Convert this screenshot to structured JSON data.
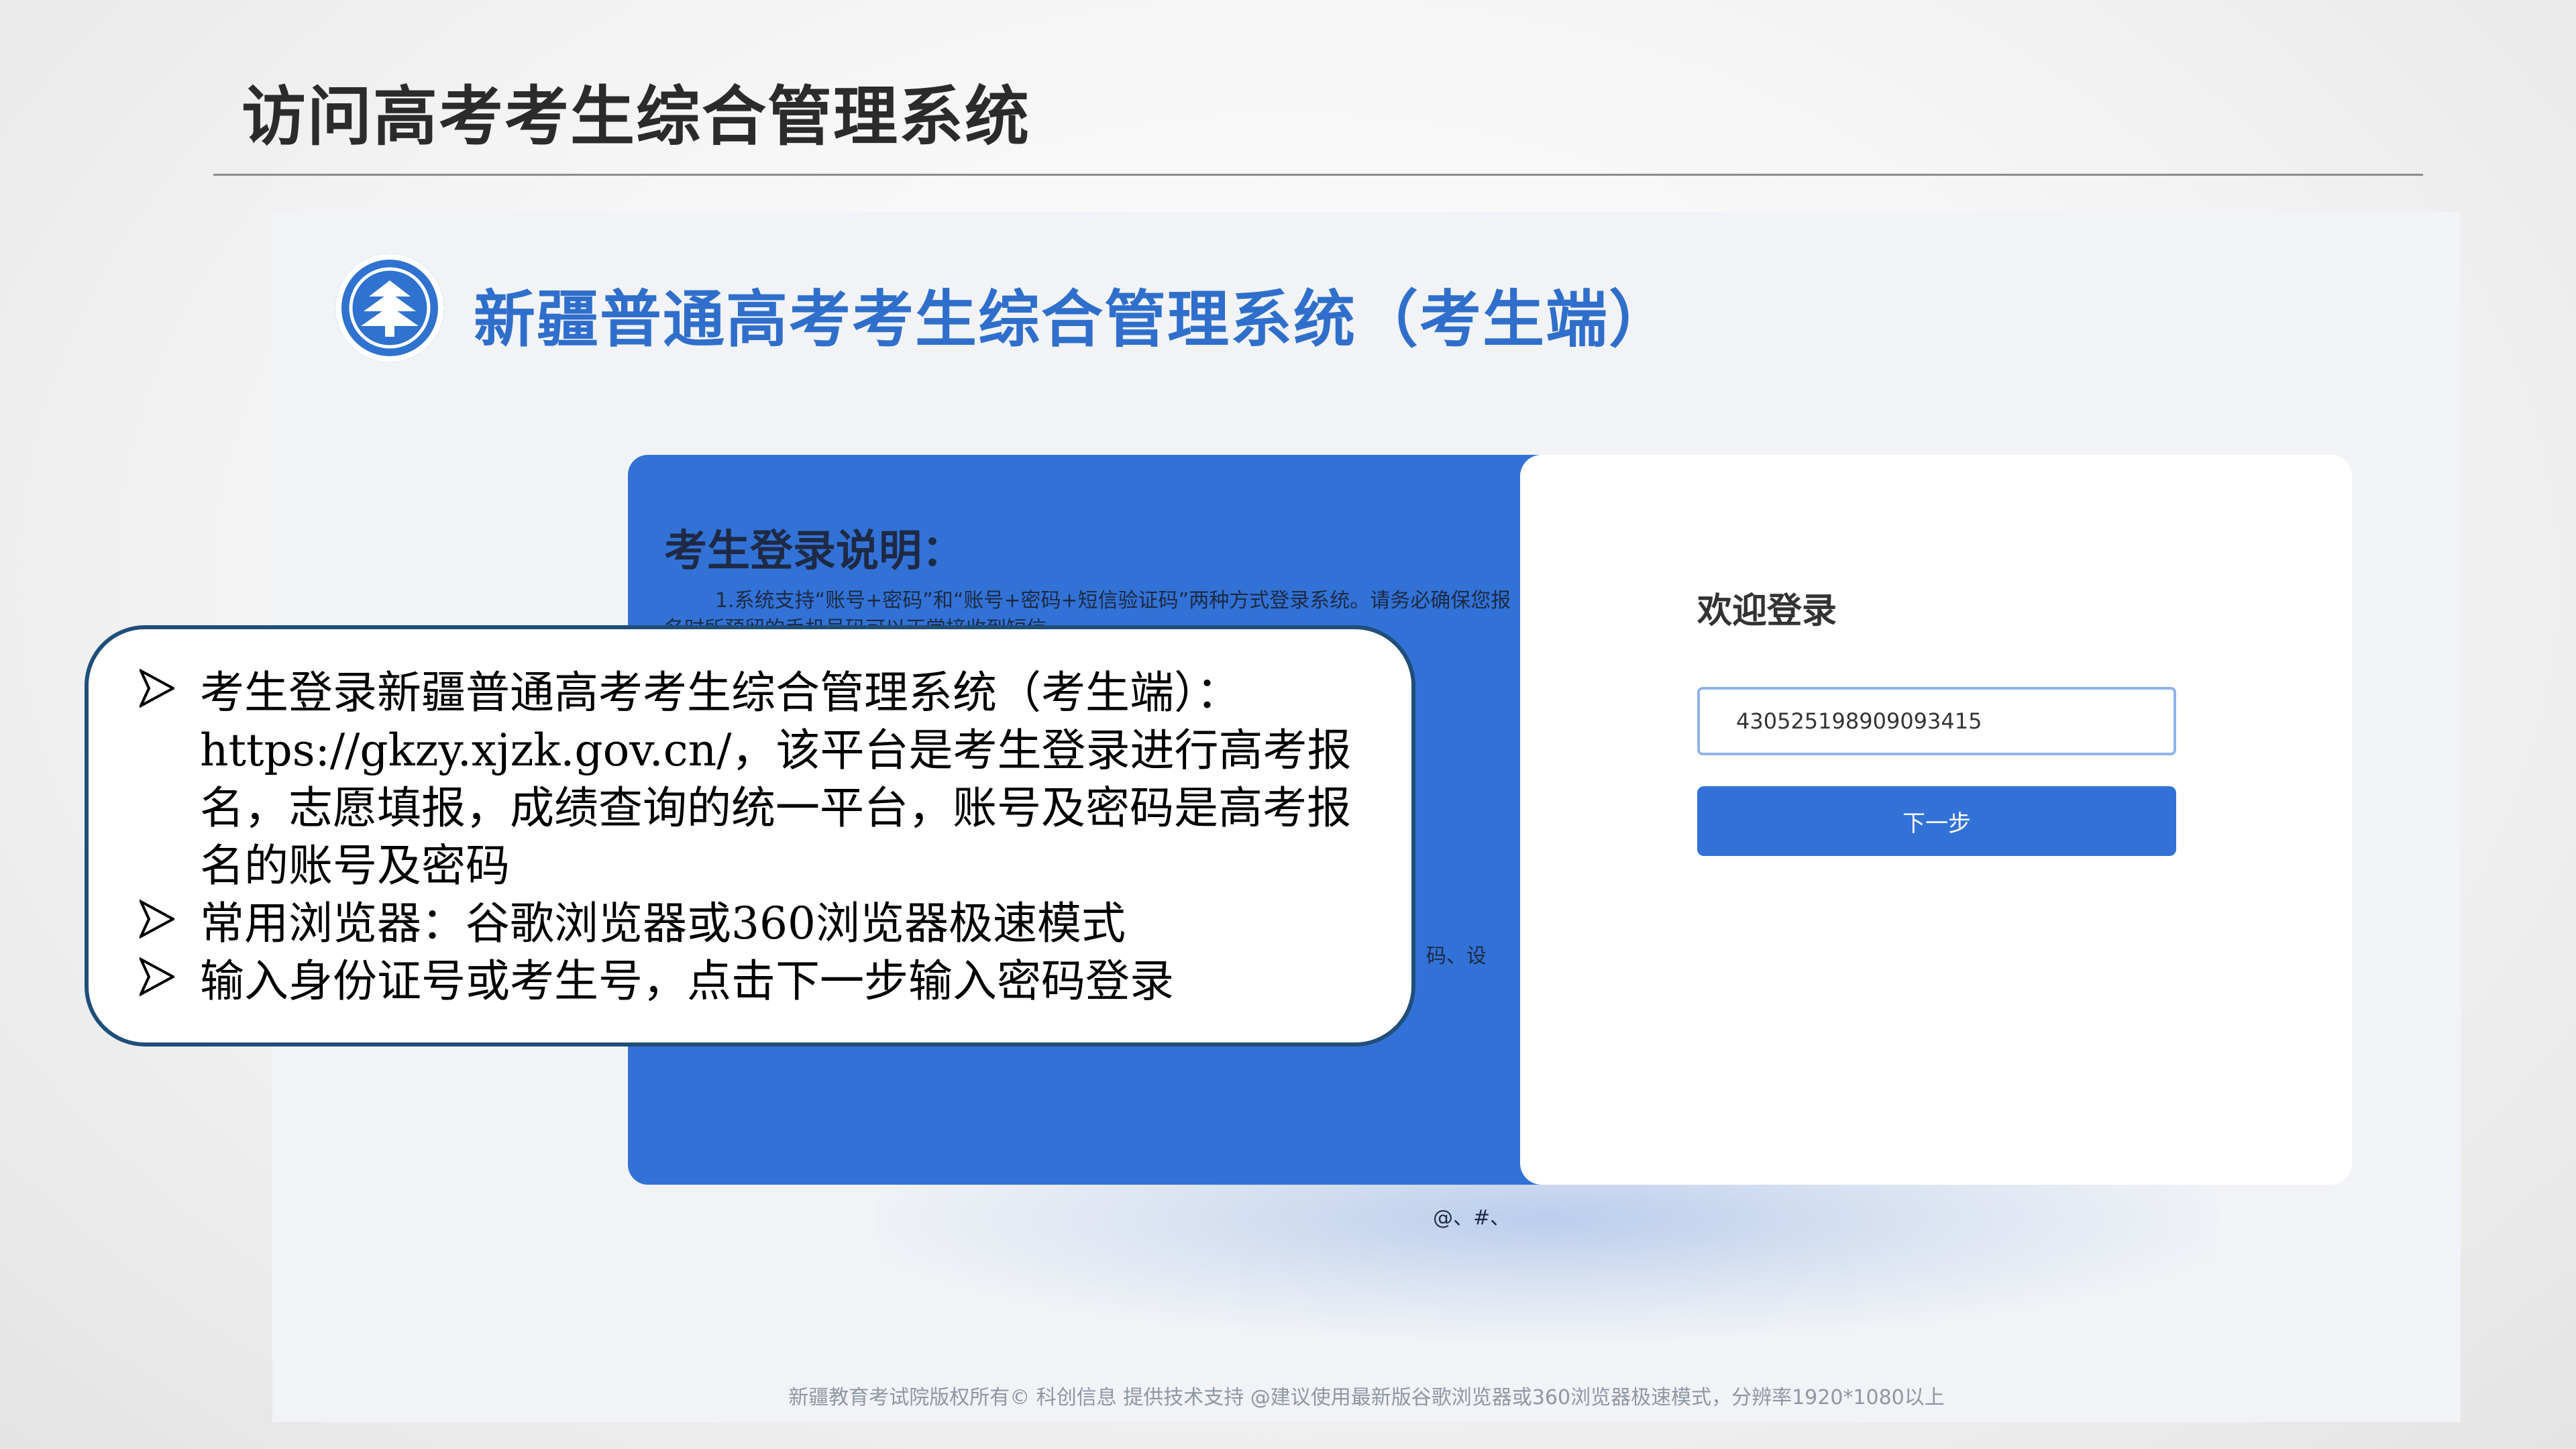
{
  "slide": {
    "title": "访问高考考生综合管理系统"
  },
  "site": {
    "system_title": "新疆普通高考考生综合管理系统（考生端）",
    "info": {
      "heading": "考生登录说明：",
      "line1": "1.系统支持“账号+密码”和“账号+密码+短信验证码”两种方式登录系统。请务必确保您报",
      "line2": "名时所预留的手机号码可以正常接收到短信。",
      "frag_right": "码、设",
      "frag_bottom": "@、#、"
    },
    "login": {
      "title": "欢迎登录",
      "id_value": "430525198909093415",
      "next_label": "下一步"
    },
    "footer": "新疆教育考试院版权所有© 科创信息 提供技术支持 @建议使用最新版谷歌浏览器或360浏览器极速模式，分辨率1920*1080以上"
  },
  "callout": {
    "bullets": [
      "考生登录新疆普通高考考生综合管理系统（考生端）：https://gkzy.xjzk.gov.cn/，该平台是考生登录进行高考报名，志愿填报，成绩查询的统一平台，账号及密码是高考报名的账号及密码",
      "常用浏览器：谷歌浏览器或360浏览器极速模式",
      "输入身份证号或考生号，点击下一步输入密码登录"
    ]
  },
  "colors": {
    "brand_blue": "#3272d6",
    "title_blue": "#2f6fcb",
    "callout_border": "#1f4e79"
  },
  "icons": {
    "logo": "exam-authority-emblem-icon",
    "bullet": "arrowhead-bullet-icon"
  }
}
